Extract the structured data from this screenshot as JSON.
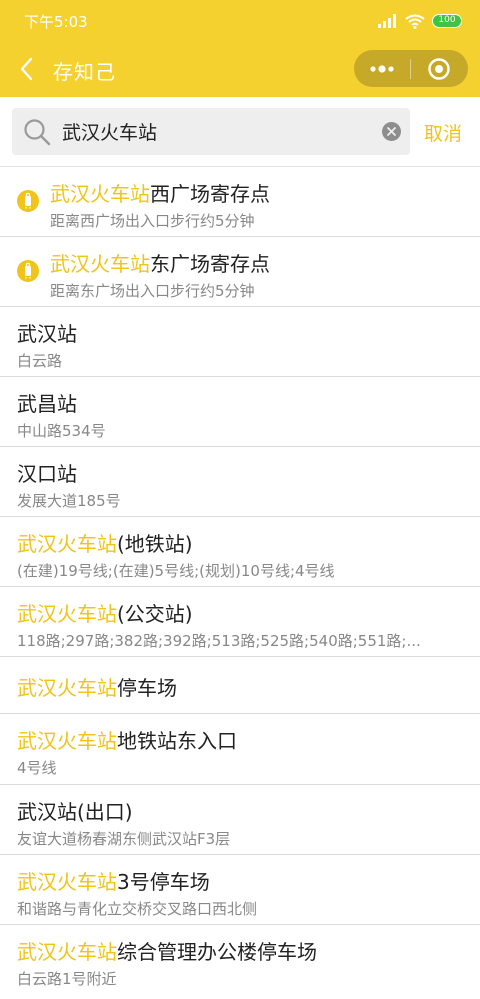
{
  "status_bar": {
    "time": "下午5:03",
    "battery": "100"
  },
  "nav": {
    "title": "存知己"
  },
  "search": {
    "query": "武汉火车站",
    "cancel_label": "取消"
  },
  "results": [
    {
      "highlight": "武汉火车站",
      "rest": "西广场寄存点",
      "sub": "距离西广场出入口步行约5分钟",
      "icon": "storage-pin-icon"
    },
    {
      "highlight": "武汉火车站",
      "rest": "东广场寄存点",
      "sub": "距离东广场出入口步行约5分钟",
      "icon": "storage-pin-icon"
    },
    {
      "highlight": "",
      "rest": "武汉站",
      "sub": "白云路"
    },
    {
      "highlight": "",
      "rest": "武昌站",
      "sub": "中山路534号"
    },
    {
      "highlight": "",
      "rest": "汉口站",
      "sub": "发展大道185号"
    },
    {
      "highlight": "武汉火车站",
      "rest": "(地铁站)",
      "sub": "(在建)19号线;(在建)5号线;(规划)10号线;4号线"
    },
    {
      "highlight": "武汉火车站",
      "rest": "(公交站)",
      "sub": "118路;297路;382路;392路;513路;525路;540路;551路;..."
    },
    {
      "highlight": "武汉火车站",
      "rest": "停车场",
      "sub": ""
    },
    {
      "highlight": "武汉火车站",
      "rest": "地铁站东入口",
      "sub": "4号线"
    },
    {
      "highlight": "",
      "rest": "武汉站(出口)",
      "sub": "友谊大道杨春湖东侧武汉站F3层"
    },
    {
      "highlight": "武汉火车站",
      "rest": "3号停车场",
      "sub": "和谐路与青化立交桥交叉路口西北侧"
    },
    {
      "highlight": "武汉火车站",
      "rest": "综合管理办公楼停车场",
      "sub": "白云路1号附近"
    }
  ],
  "colors": {
    "brand": "#f5d130",
    "highlight": "#f0c419",
    "capsule": "#c7a92a"
  }
}
